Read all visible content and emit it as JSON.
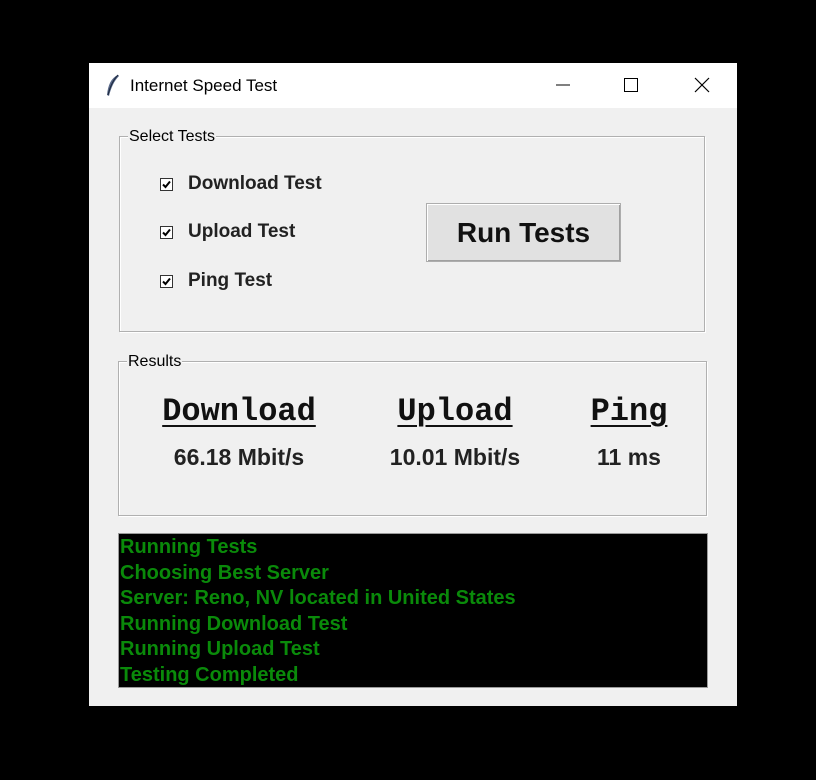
{
  "window": {
    "title": "Internet Speed Test",
    "icon": "feather-icon",
    "controls": [
      "minimize-icon",
      "maximize-icon",
      "close-icon"
    ]
  },
  "tests": {
    "group_label": "Select Tests",
    "items": [
      {
        "label": "Download Test",
        "checked": true
      },
      {
        "label": "Upload Test",
        "checked": true
      },
      {
        "label": "Ping Test",
        "checked": true
      }
    ],
    "run_button_label": "Run Tests"
  },
  "results": {
    "group_label": "Results",
    "download": {
      "heading": "Download",
      "value": "66.18 Mbit/s"
    },
    "upload": {
      "heading": "Upload",
      "value": "10.01 Mbit/s"
    },
    "ping": {
      "heading": "Ping",
      "value": "11 ms"
    }
  },
  "log": {
    "lines": [
      "Running Tests",
      "Choosing Best Server",
      "Server: Reno, NV located in United States",
      "Running Download Test",
      "Running Upload Test",
      "Testing Completed"
    ],
    "text_color": "#0a8a0a",
    "background": "#000000"
  }
}
